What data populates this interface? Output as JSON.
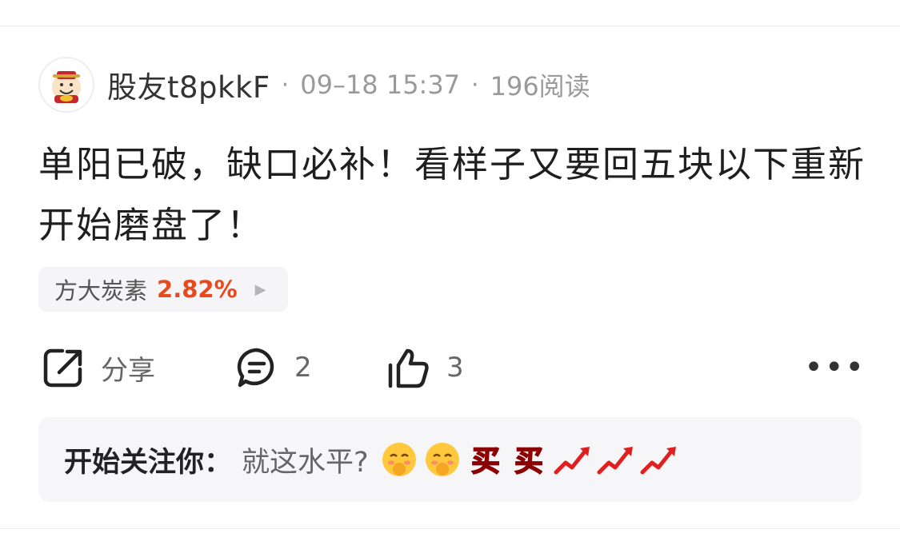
{
  "post": {
    "author": "股友t8pkkF",
    "separator": "·",
    "date": "09–18 15:37",
    "reads": "196阅读",
    "content": "单阳已破，缺口必补！看样子又要回五块以下重新开始磨盘了！"
  },
  "stock_tag": {
    "name": "方大炭素",
    "change": "2.82%"
  },
  "actions": {
    "share_label": "分享",
    "comment_count": "2",
    "like_count": "3",
    "more_label": "•••"
  },
  "reply": {
    "name": "开始关注你",
    "colon": "：",
    "text": "就这水平?",
    "emojis": [
      "shy-smile-emoji",
      "shy-smile-emoji",
      "buy-emoji",
      "buy-emoji",
      "uptrend-emoji",
      "uptrend-emoji",
      "uptrend-emoji"
    ],
    "emoji_texts": [
      "买",
      "买"
    ]
  },
  "colors": {
    "accent_red": "#e8491d",
    "meta_gray": "#9a9a9a",
    "tag_bg": "#f5f5f7"
  }
}
